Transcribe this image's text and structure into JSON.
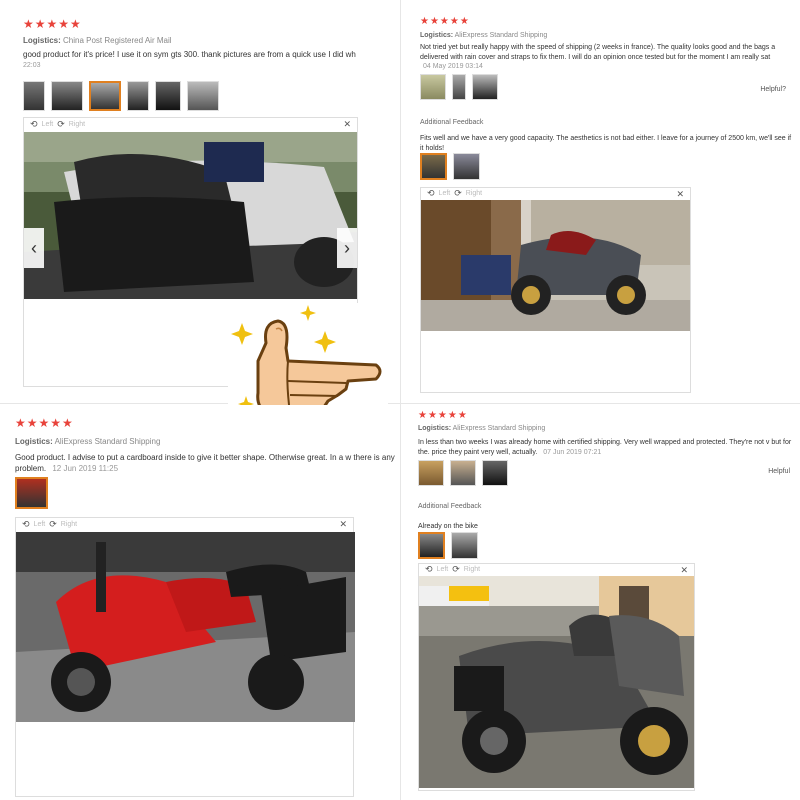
{
  "review1": {
    "stars": "★★★★★",
    "logistics_label": "Logistics:",
    "logistics_value": "China Post Registered Air Mail",
    "text": "good product for it's price! I use it on sym gts 300. thank pictures are from a quick use I did wh",
    "date": "22:03",
    "viewer_left": "Left",
    "viewer_right": "Right",
    "close": "✕"
  },
  "review2": {
    "stars": "★★★★★",
    "logistics_label": "Logistics:",
    "logistics_value": "AliExpress Standard Shipping",
    "text": "Not tried yet but really happy with the speed of shipping (2 weeks in france). The quality looks good and the bags a delivered with rain cover and straps to fix them. I will do an opinion once tested but for the moment I am really sat",
    "date": "04 May 2019 03:14",
    "helpful": "Helpful?",
    "additional_label": "Additional Feedback",
    "additional_text": "Fits well and we have a very good capacity. The aesthetics is not bad either. I leave for a journey of 2500 km, we'll see if it holds!",
    "viewer_left": "Left",
    "viewer_right": "Right",
    "close": "✕"
  },
  "review3": {
    "stars": "★★★★★",
    "logistics_label": "Logistics:",
    "logistics_value": "AliExpress Standard Shipping",
    "text": "Good product. I advise to put a cardboard inside to give it better shape. Otherwise great. In a w there is any problem.",
    "date": "12 Jun 2019 11:25",
    "viewer_left": "Left",
    "viewer_right": "Right",
    "close": "✕"
  },
  "review4": {
    "stars": "★★★★★",
    "logistics_label": "Logistics:",
    "logistics_value": "AliExpress Standard Shipping",
    "text": "In less than two weeks I was already home with certified shipping. Very well wrapped and protected. They're not v but for the. price they paint very well, actually.",
    "date": "07 Jun 2019 07:21",
    "helpful": "Helpful",
    "additional_label": "Additional Feedback",
    "additional_text": "Already on the bike",
    "viewer_left": "Left",
    "viewer_right": "Right",
    "close": "✕"
  },
  "icons": {
    "rotate_left": "rotate-left-icon",
    "rotate_right": "rotate-right-icon",
    "close": "close-icon",
    "prev": "chevron-left-icon",
    "next": "chevron-right-icon",
    "thumbs_up": "thumbs-up-sticker"
  },
  "colors": {
    "star": "#e8433b",
    "selected_thumb": "#e08020"
  }
}
